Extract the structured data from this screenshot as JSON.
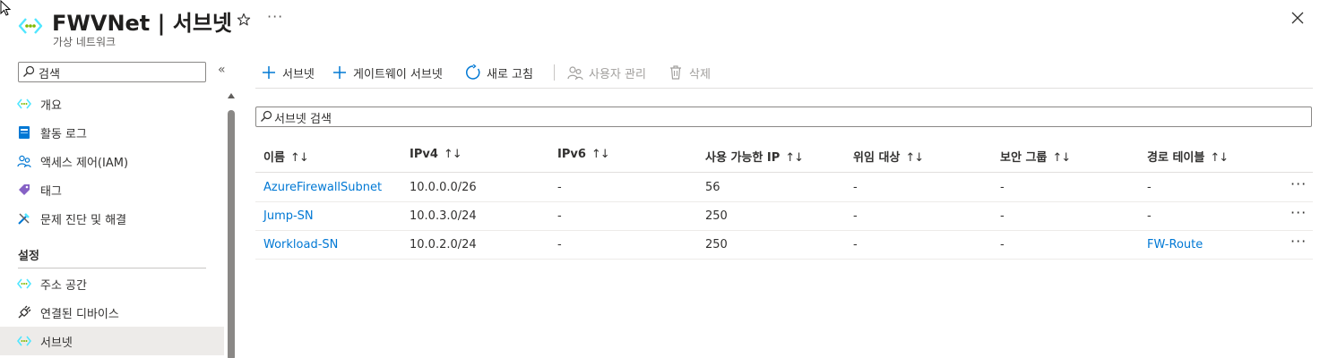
{
  "header": {
    "title": "FWVNet | 서브넷",
    "subtitle": "가상 네트워크",
    "more_label": "···"
  },
  "sidebar": {
    "search_placeholder": "검색",
    "collapse_label": "«",
    "items": [
      {
        "label": "개요",
        "icon": "vnet-icon"
      },
      {
        "label": "활동 로그",
        "icon": "activity-log-icon"
      },
      {
        "label": "액세스 제어(IAM)",
        "icon": "iam-icon"
      },
      {
        "label": "태그",
        "icon": "tag-icon"
      },
      {
        "label": "문제 진단 및 해결",
        "icon": "diagnose-icon"
      }
    ],
    "section_title": "설정",
    "settings_items": [
      {
        "label": "주소 공간",
        "icon": "vnet-icon"
      },
      {
        "label": "연결된 디바이스",
        "icon": "plug-icon"
      },
      {
        "label": "서브넷",
        "icon": "vnet-icon",
        "selected": true
      }
    ]
  },
  "toolbar": {
    "add_subnet": "서브넷",
    "add_gateway_subnet": "게이트웨이 서브넷",
    "refresh": "새로 고침",
    "manage_users": "사용자 관리",
    "delete": "삭제"
  },
  "filter": {
    "placeholder": "서브넷 검색"
  },
  "table": {
    "sort_glyph": "↑↓",
    "columns": [
      "이름",
      "IPv4",
      "IPv6",
      "사용 가능한 IP",
      "위임 대상",
      "보안 그룹",
      "경로 테이블"
    ],
    "rows": [
      {
        "name": "AzureFirewallSubnet",
        "ipv4": "10.0.0.0/26",
        "ipv6": "-",
        "available_ips": "56",
        "delegated_to": "-",
        "security_group": "-",
        "route_table": "-"
      },
      {
        "name": "Jump-SN",
        "ipv4": "10.0.3.0/24",
        "ipv6": "-",
        "available_ips": "250",
        "delegated_to": "-",
        "security_group": "-",
        "route_table": "-"
      },
      {
        "name": "Workload-SN",
        "ipv4": "10.0.2.0/24",
        "ipv6": "-",
        "available_ips": "250",
        "delegated_to": "-",
        "security_group": "-",
        "route_table": "FW-Route"
      }
    ],
    "row_more_label": "···"
  },
  "colors": {
    "accent": "#0078d4",
    "vnet_cyan": "#50e6ff",
    "vnet_green": "#7fba00"
  }
}
